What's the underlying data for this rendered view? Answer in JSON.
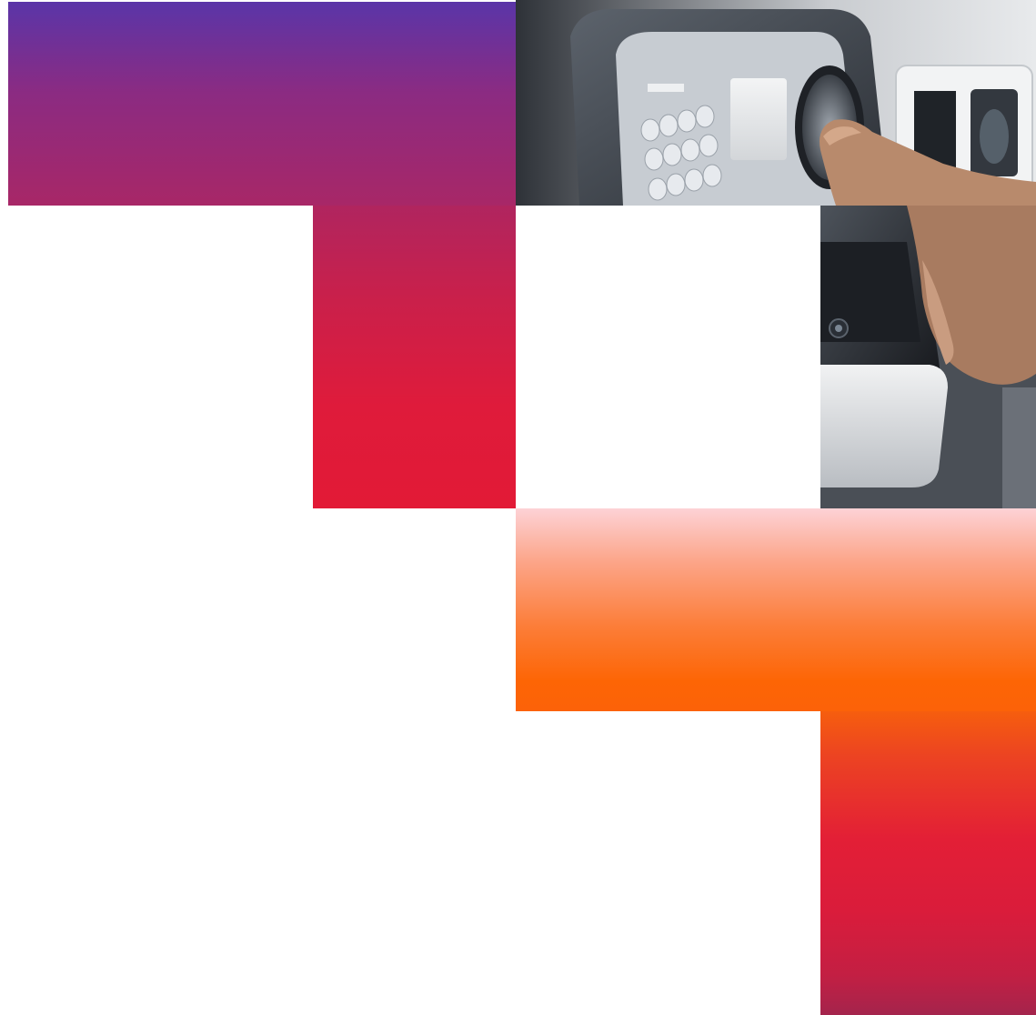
{
  "colors": {
    "background": "#ffffff",
    "purple_gradient": [
      "#5a35a8",
      "#8b2b82",
      "#a82767",
      "#c9204b",
      "#e21a36"
    ],
    "orange_gradient": [
      "#fdd2d6",
      "#fca487",
      "#fc7d38",
      "#fd6505",
      "#e31f36",
      "#a4244c"
    ]
  },
  "photo": {
    "subject": "fingerprint-scanner-terminal"
  }
}
